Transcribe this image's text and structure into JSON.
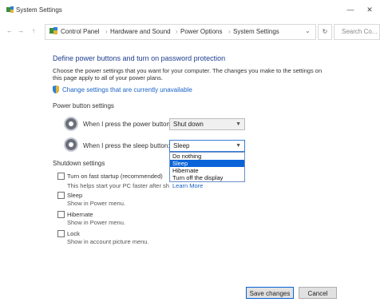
{
  "window": {
    "title": "System Settings",
    "minimize": "—",
    "close": "✕"
  },
  "nav": {
    "back": "←",
    "forward": "→",
    "up": "↑",
    "breadcrumb": [
      "Control Panel",
      "Hardware and Sound",
      "Power Options",
      "System Settings"
    ],
    "addr_dropdown": "⌄",
    "refresh": "↻",
    "search_placeholder": "Search Co..."
  },
  "content": {
    "heading": "Define power buttons and turn on password protection",
    "description": "Choose the power settings that you want for your computer. The changes you make to the settings on this page apply to all of your power plans.",
    "change_link": "Change settings that are currently unavailable",
    "section_power": "Power button settings",
    "power_button_label": "When I press the power button:",
    "power_button_value": "Shut down",
    "sleep_button_label": "When I press the sleep button:",
    "sleep_button_value": "Sleep",
    "sleep_options": [
      "Do nothing",
      "Sleep",
      "Hibernate",
      "Turn off the display"
    ],
    "sleep_selected_index": 1,
    "section_shutdown": "Shutdown settings",
    "options": [
      {
        "title": "Turn on fast startup (recommended)",
        "sub": "This helps start your PC faster after shutdown. Restart isn't affected.",
        "checked": false
      },
      {
        "title": "Sleep",
        "sub": "Show in Power menu.",
        "checked": false
      },
      {
        "title": "Hibernate",
        "sub": "Show in Power menu.",
        "checked": false
      },
      {
        "title": "Lock",
        "sub": "Show in account picture menu.",
        "checked": false
      }
    ],
    "learn_more": "Learn More"
  },
  "footer": {
    "save": "Save changes",
    "cancel": "Cancel"
  }
}
